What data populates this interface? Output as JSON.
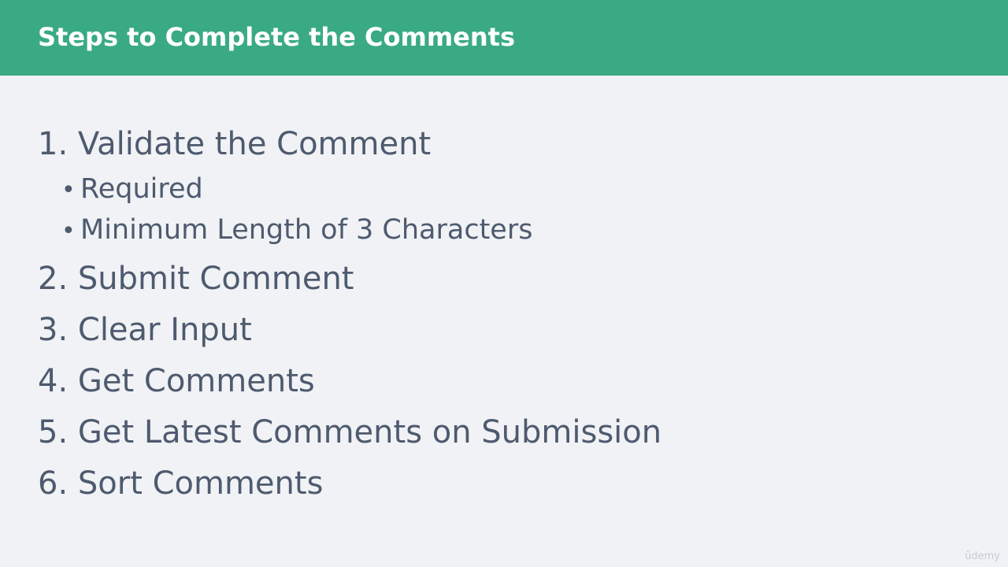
{
  "header": {
    "title": "Steps to Complete the Comments",
    "background_color": "#3aaa85",
    "text_color": "#ffffff"
  },
  "content": {
    "text_color": "#4e5a6e",
    "items": [
      {
        "number": "1.",
        "label": "Validate the Comment",
        "sub_items": [
          "Required",
          "Minimum Length of 3 Characters"
        ]
      },
      {
        "number": "2.",
        "label": "Submit Comment"
      },
      {
        "number": "3.",
        "label": "Clear Input"
      },
      {
        "number": "4.",
        "label": "Get Comments"
      },
      {
        "number": "5.",
        "label": "Get Latest Comments on Submission"
      },
      {
        "number": "6.",
        "label": "Sort Comments"
      }
    ],
    "bullet_glyph": "•"
  },
  "watermark": {
    "text": "ûdemy"
  }
}
